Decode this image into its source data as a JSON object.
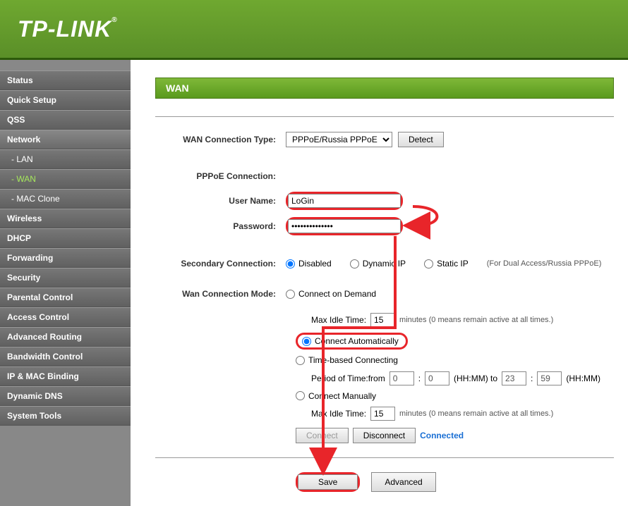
{
  "brand": "TP-LINK",
  "sidebar": {
    "items": [
      {
        "label": "Status"
      },
      {
        "label": "Quick Setup"
      },
      {
        "label": "QSS"
      },
      {
        "label": "Network",
        "activeParent": true
      },
      {
        "label": "- LAN",
        "sub": true
      },
      {
        "label": "- WAN",
        "sub": true,
        "active": true
      },
      {
        "label": "- MAC Clone",
        "sub": true
      },
      {
        "label": "Wireless"
      },
      {
        "label": "DHCP"
      },
      {
        "label": "Forwarding"
      },
      {
        "label": "Security"
      },
      {
        "label": "Parental Control"
      },
      {
        "label": "Access Control"
      },
      {
        "label": "Advanced Routing"
      },
      {
        "label": "Bandwidth Control"
      },
      {
        "label": "IP & MAC Binding"
      },
      {
        "label": "Dynamic DNS"
      },
      {
        "label": "System Tools"
      }
    ]
  },
  "page": {
    "title": "WAN",
    "labels": {
      "conn_type": "WAN Connection Type:",
      "pppoe_conn": "PPPoE Connection:",
      "username": "User Name:",
      "password": "Password:",
      "secondary": "Secondary Connection:",
      "mode": "Wan Connection Mode:"
    },
    "conn_type_value": "PPPoE/Russia PPPoE",
    "detect": "Detect",
    "username_value": "LoGin",
    "password_value": "••••••••••••••",
    "secondary": {
      "disabled": "Disabled",
      "dynamic": "Dynamic IP",
      "static": "Static IP",
      "note": "(For Dual Access/Russia PPPoE)"
    },
    "mode": {
      "demand": "Connect on Demand",
      "max_idle": "Max Idle Time:",
      "idle1": "15",
      "idle2": "15",
      "minutes_note": "minutes (0 means remain active at all times.)",
      "auto": "Connect Automatically",
      "time": "Time-based Connecting",
      "period": "Period of Time:from",
      "to": "(HH:MM) to",
      "hhmm": "(HH:MM)",
      "t_from_h": "0",
      "t_from_m": "0",
      "t_to_h": "23",
      "t_to_m": "59",
      "manual": "Connect Manually",
      "connect": "Connect",
      "disconnect": "Disconnect",
      "status": "Connected"
    },
    "save": "Save",
    "advanced": "Advanced"
  }
}
